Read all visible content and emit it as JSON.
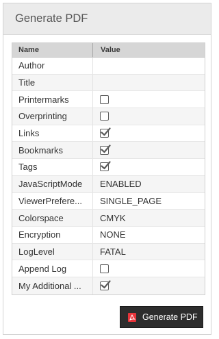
{
  "panel": {
    "title": "Generate PDF"
  },
  "grid": {
    "columns": [
      "Name",
      "Value"
    ],
    "rows": [
      {
        "name": "Author",
        "value": "",
        "checkbox": null
      },
      {
        "name": "Title",
        "value": "",
        "checkbox": null
      },
      {
        "name": "Printermarks",
        "value": "",
        "checkbox": false
      },
      {
        "name": "Overprinting",
        "value": "",
        "checkbox": false
      },
      {
        "name": "Links",
        "value": "",
        "checkbox": true
      },
      {
        "name": "Bookmarks",
        "value": "",
        "checkbox": true
      },
      {
        "name": "Tags",
        "value": "",
        "checkbox": true
      },
      {
        "name": "JavaScriptMode",
        "value": "ENABLED",
        "checkbox": null
      },
      {
        "name": "ViewerPrefere...",
        "value": "SINGLE_PAGE",
        "checkbox": null
      },
      {
        "name": "Colorspace",
        "value": "CMYK",
        "checkbox": null
      },
      {
        "name": "Encryption",
        "value": "NONE",
        "checkbox": null
      },
      {
        "name": "LogLevel",
        "value": "FATAL",
        "checkbox": null
      },
      {
        "name": "Append Log",
        "value": "",
        "checkbox": false
      },
      {
        "name": "My Additional ...",
        "value": "",
        "checkbox": true
      }
    ]
  },
  "actions": {
    "generate_label": "Generate PDF",
    "generate_icon": "pdf-icon"
  },
  "colors": {
    "header_bg": "#ebebeb",
    "grid_header_bg": "#d6d6d6",
    "button_bg": "#2d2d2d",
    "pdf_icon_red": "#e8343a"
  }
}
